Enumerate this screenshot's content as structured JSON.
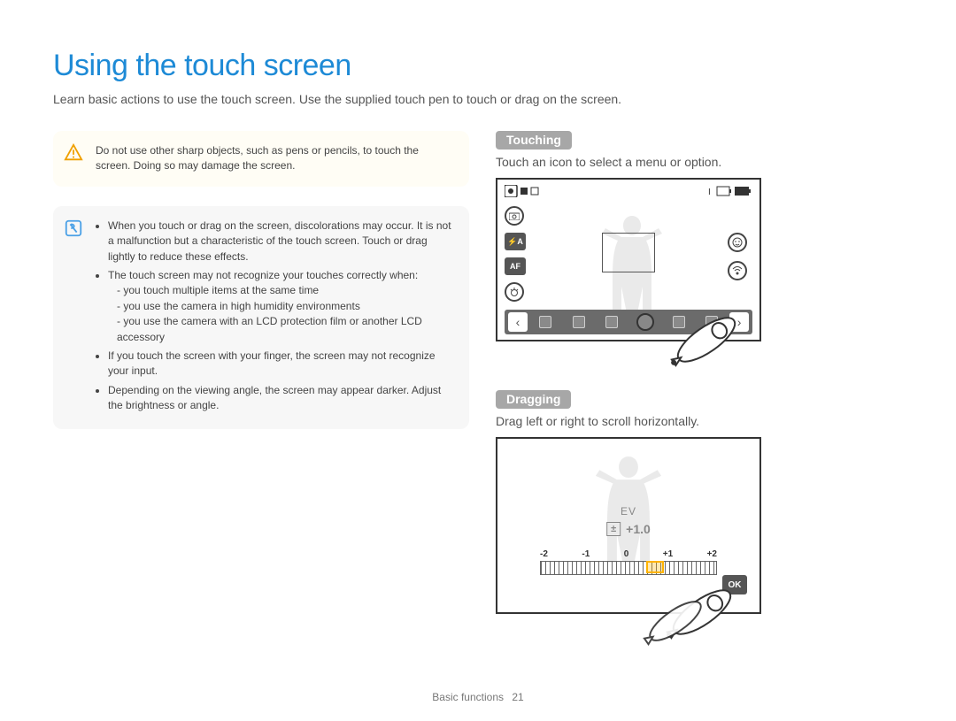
{
  "title": "Using the touch screen",
  "intro": "Learn basic actions to use the touch screen. Use the supplied touch pen to touch or drag on the screen.",
  "warning": "Do not use other sharp objects, such as pens or pencils, to touch the screen. Doing so may damage the screen.",
  "notes": {
    "n1": "When you touch or drag on the screen, discolorations may occur. It is not a malfunction but a characteristic of the touch screen. Touch or drag lightly to reduce these effects.",
    "n2_lead": "The touch screen may not recognize your touches correctly when:",
    "n2a": "you touch multiple items at the same time",
    "n2b": "you use the camera in high humidity environments",
    "n2c": "you use the camera with an LCD protection film or another LCD accessory",
    "n3": "If you touch the screen with your finger, the screen may not recognize your input.",
    "n4a": "Depending on the viewing angle, the screen may appear darker.",
    "n4b": "Adjust the brightness or angle."
  },
  "touching": {
    "label": "Touching",
    "desc": "Touch an icon to select a menu or option."
  },
  "dragging": {
    "label": "Dragging",
    "desc": "Drag left or right to scroll horizontally."
  },
  "cam1": {
    "flash": "⚡A",
    "af": "AF",
    "arrow_left": "‹",
    "arrow_right": "›"
  },
  "cam2": {
    "ev_label": "EV",
    "ev_value": "+1.0",
    "scale": {
      "a": "-2",
      "b": "-1",
      "c": "0",
      "d": "+1",
      "e": "+2"
    },
    "ok": "OK"
  },
  "footer": {
    "section": "Basic functions",
    "page": "21"
  }
}
